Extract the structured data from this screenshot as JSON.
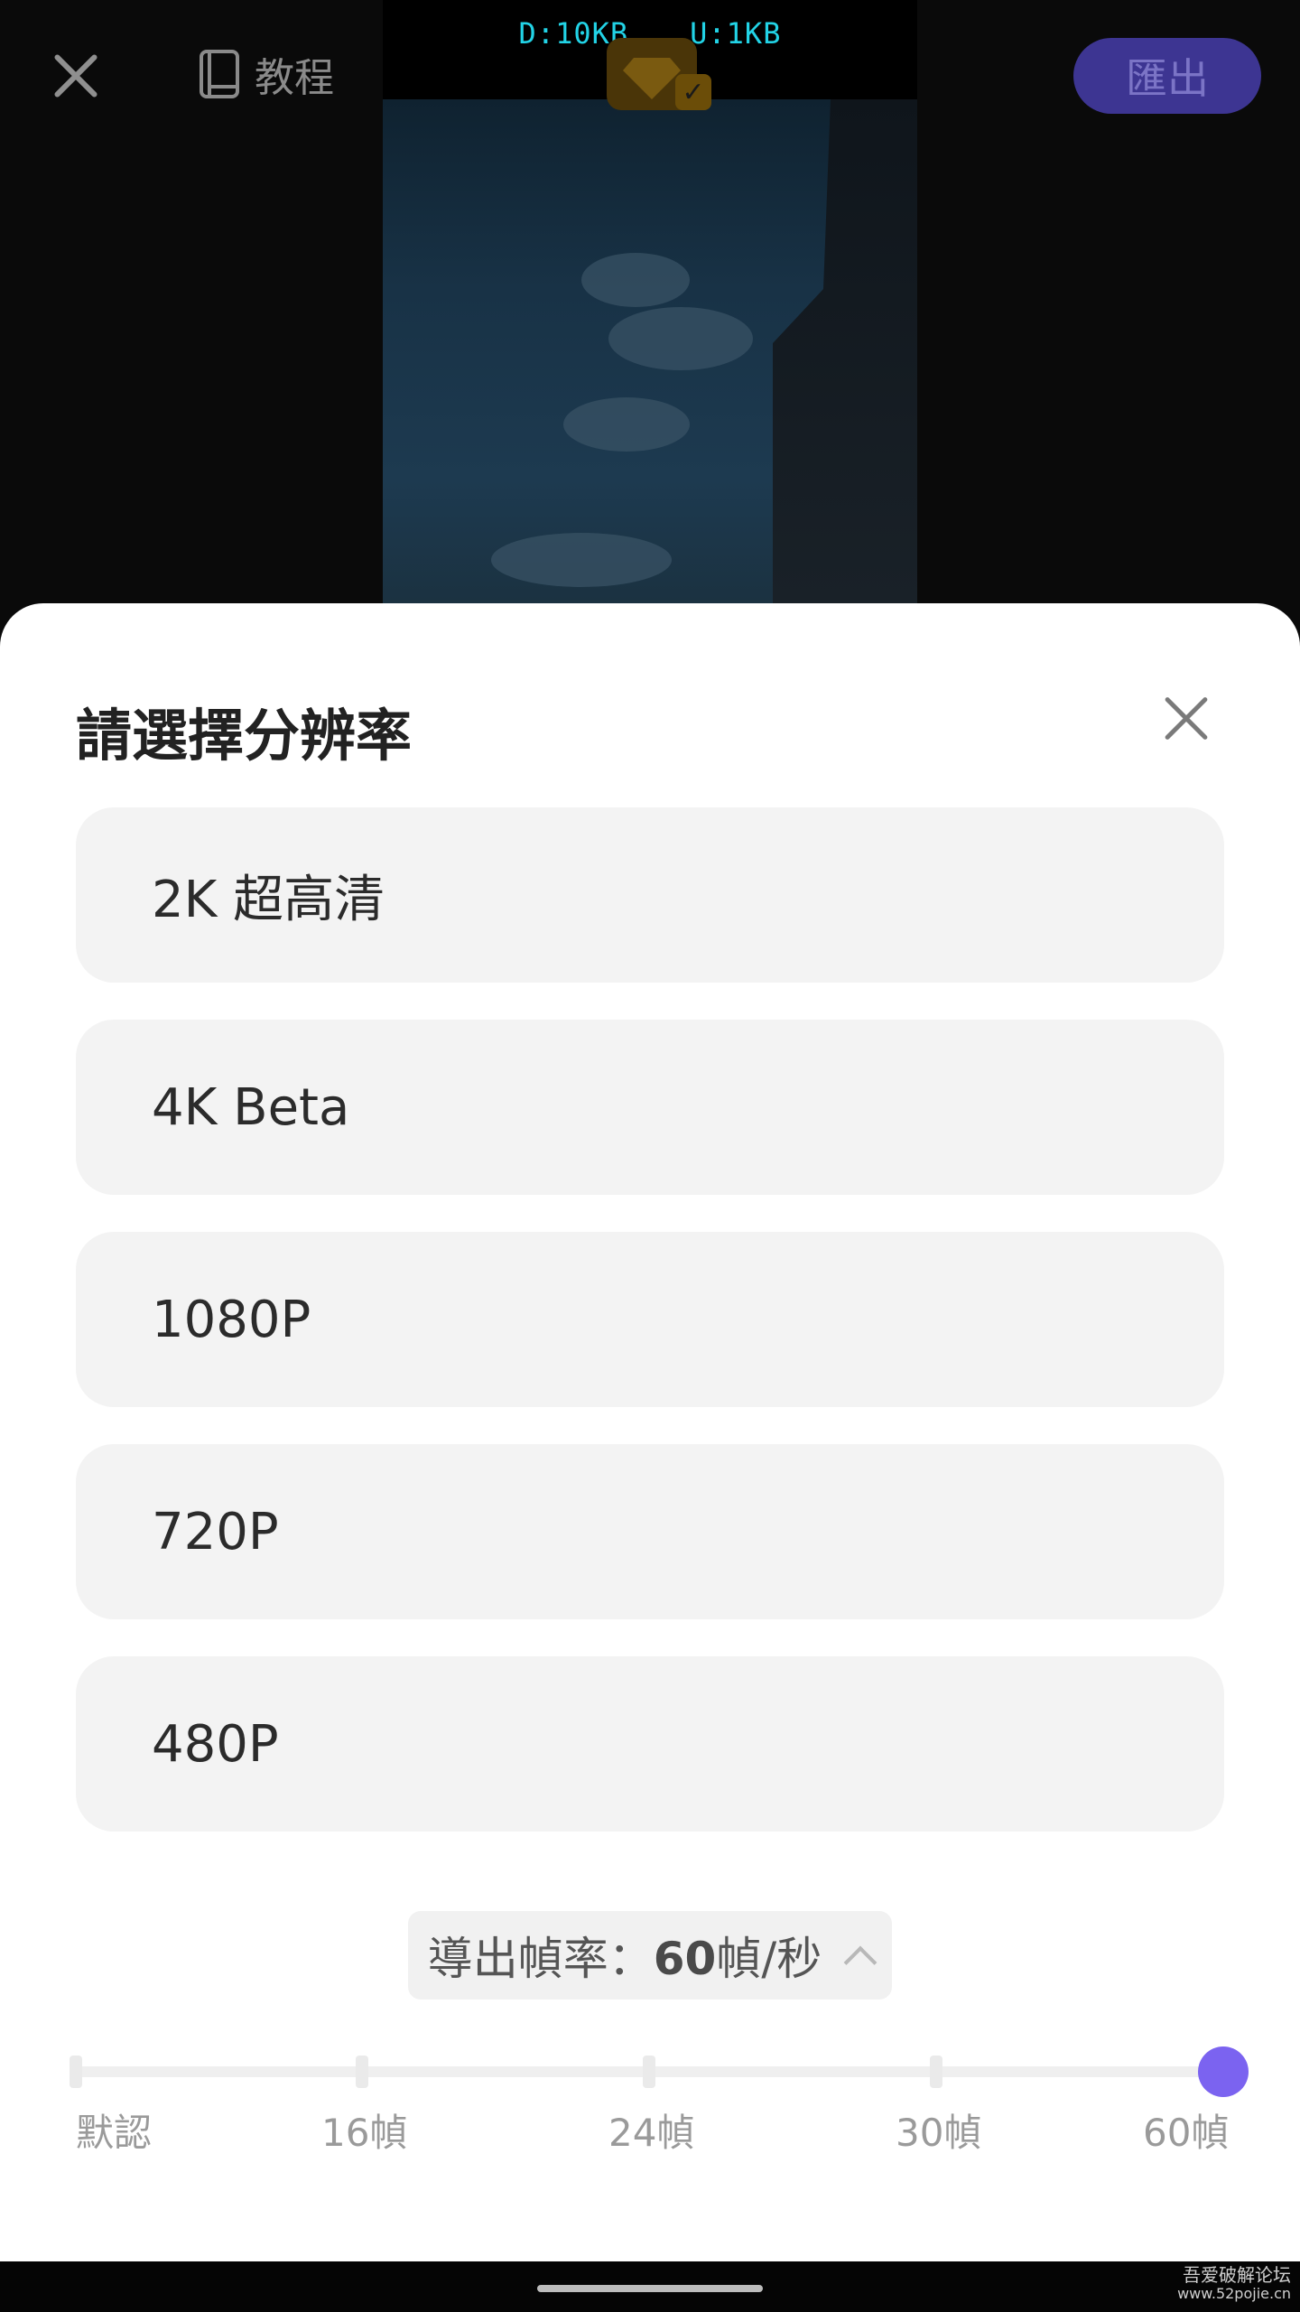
{
  "topbar": {
    "tutorial_label": "教程",
    "export_label": "匯出"
  },
  "preview": {
    "download_stat": "D:10KB",
    "upload_stat": "U:1KB"
  },
  "sheet": {
    "title": "請選擇分辨率",
    "options": [
      {
        "label": "2K 超高清"
      },
      {
        "label": "4K Beta"
      },
      {
        "label": "1080P"
      },
      {
        "label": "720P"
      },
      {
        "label": "480P"
      }
    ],
    "fps_toggle": {
      "prefix": "導出幀率：",
      "value": "60",
      "unit": "幀/秒"
    },
    "fps_slider": {
      "labels": [
        "默認",
        "16幀",
        "24幀",
        "30幀",
        "60幀"
      ],
      "selected_index": 4,
      "accent_color": "#7b63f0"
    }
  },
  "navbar": {
    "watermark_line1": "吾爱破解论坛",
    "watermark_line2": "www.52pojie.cn"
  }
}
